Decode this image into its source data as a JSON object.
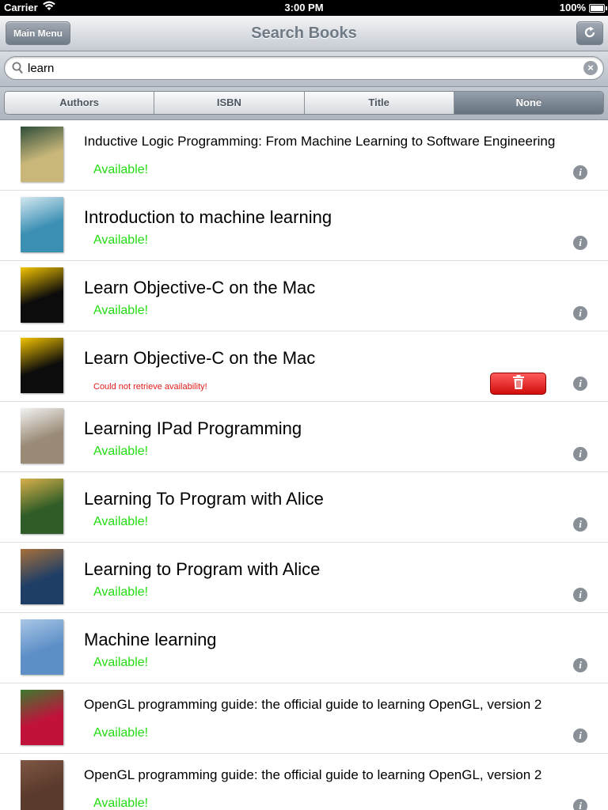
{
  "status_bar": {
    "carrier": "Carrier",
    "time": "3:00 PM",
    "battery": "100%"
  },
  "nav": {
    "title": "Search Books",
    "main_menu_label": "Main Menu",
    "refresh_icon": "refresh-icon"
  },
  "search": {
    "value": "learn",
    "placeholder": ""
  },
  "scope": {
    "segments": [
      "Authors",
      "ISBN",
      "Title",
      "None"
    ],
    "selected": "None"
  },
  "colors": {
    "available": "#22dd11",
    "error": "#e21b1b",
    "delete": "#e31414"
  },
  "books": [
    {
      "title": "Inductive Logic Programming: From Machine Learning to Software Engineering",
      "status": "Available!",
      "cover": [
        "#c9b77a",
        "#2f4e3a"
      ]
    },
    {
      "title": "Introduction to machine learning",
      "status": "Available!",
      "cover": [
        "#3b8fb3",
        "#d4e8f0"
      ]
    },
    {
      "title": "Learn Objective-C on the Mac",
      "status": "Available!",
      "cover": [
        "#0c0c0c",
        "#f2c300"
      ]
    },
    {
      "title": "Learn Objective-C on the Mac",
      "status": "Could not retrieve availability!",
      "cover": [
        "#0c0c0c",
        "#f2c300"
      ],
      "deletable": true
    },
    {
      "title": "Learning IPad Programming",
      "status": "Available!",
      "cover": [
        "#9a8b76",
        "#f2f2f2"
      ]
    },
    {
      "title": "Learning To Program with Alice",
      "status": "Available!",
      "cover": [
        "#2f5c27",
        "#d9b04a"
      ]
    },
    {
      "title": "Learning to Program with Alice",
      "status": "Available!",
      "cover": [
        "#1f3e66",
        "#a6703a"
      ]
    },
    {
      "title": "Machine learning",
      "status": "Available!",
      "cover": [
        "#5d8fc7",
        "#a9c6e6"
      ]
    },
    {
      "title": "OpenGL programming guide: the official guide to learning OpenGL, version 2",
      "status": "Available!",
      "cover": [
        "#c1123b",
        "#3c7a2f"
      ]
    },
    {
      "title": "OpenGL programming guide: the official guide to learning OpenGL, version 2",
      "status": "Available!",
      "cover": [
        "#5a3a2c",
        "#7e5644"
      ]
    }
  ]
}
